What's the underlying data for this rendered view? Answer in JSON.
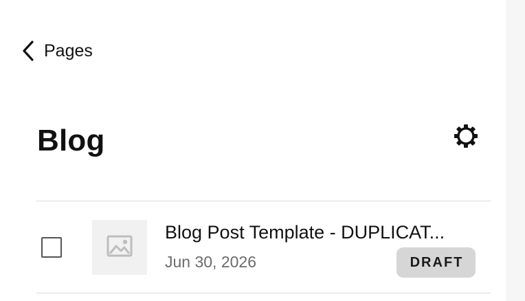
{
  "nav": {
    "back_label": "Pages",
    "back_icon": "chevron-left-icon"
  },
  "header": {
    "title": "Blog",
    "settings_icon": "gear-icon"
  },
  "posts": [
    {
      "title": "Blog Post Template - DUPLICAT...",
      "date": "Jun 30, 2026",
      "status": "DRAFT",
      "thumbnail_icon": "image-placeholder-icon",
      "checked": false
    }
  ],
  "colors": {
    "text": "#111111",
    "muted_text": "#6b6b6b",
    "badge_bg": "#d6d6d6",
    "thumbnail_bg": "#f1f1f1",
    "divider": "#d9d9d9"
  }
}
